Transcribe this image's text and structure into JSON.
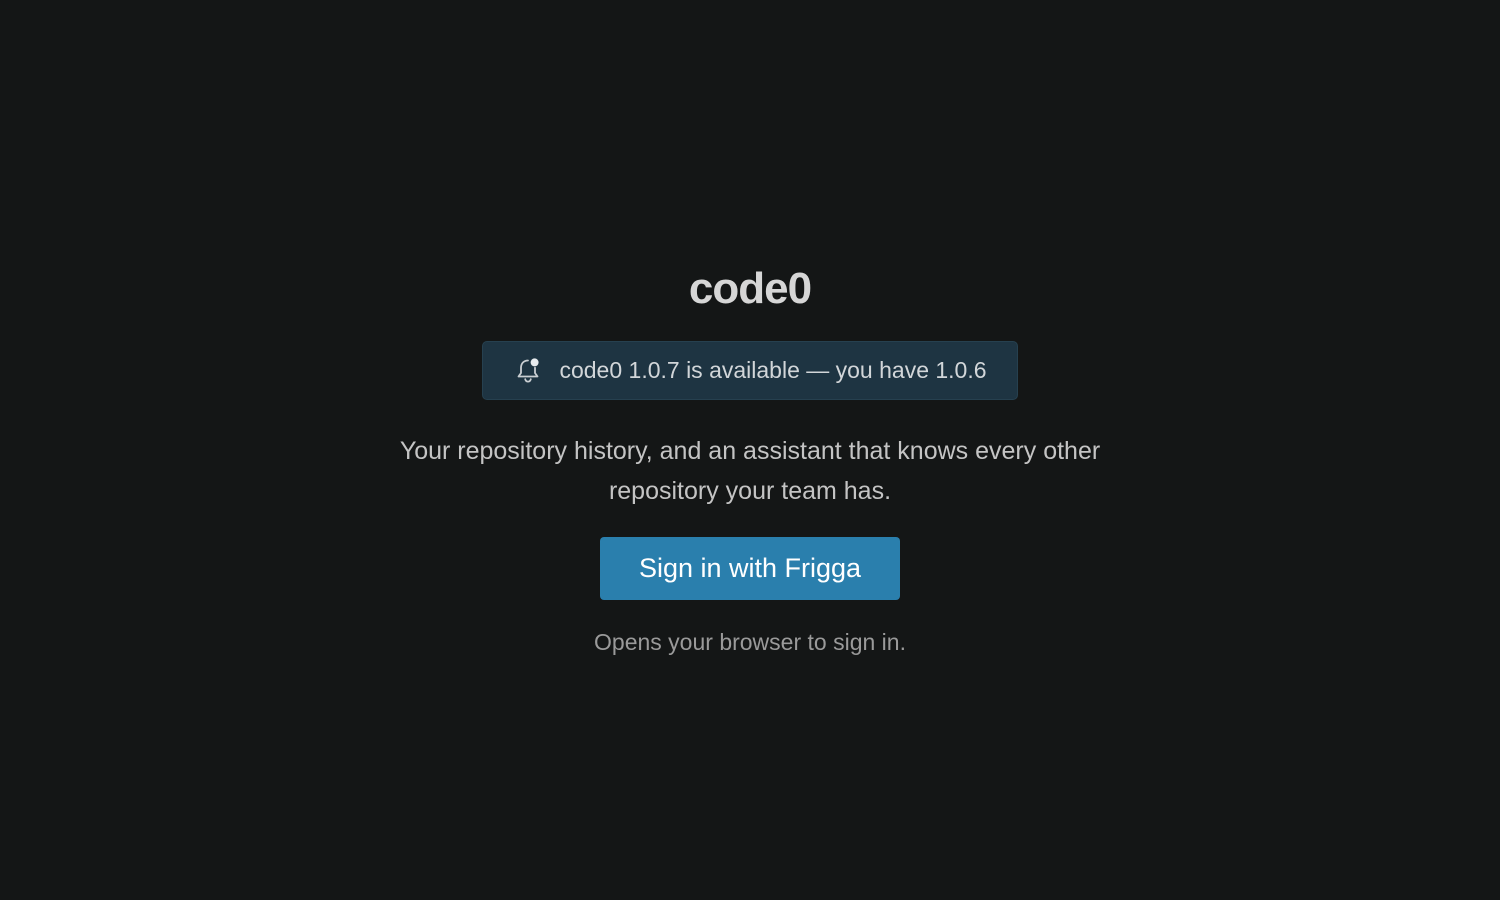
{
  "app": {
    "title": "code0"
  },
  "update_banner": {
    "icon": "bell-notification-icon",
    "text": "code0 1.0.7 is available — you have 1.0.6"
  },
  "tagline": "Your repository history, and an assistant that knows every other repository your team has.",
  "signin": {
    "button_label": "Sign in with Frigga",
    "note": "Opens your browser to sign in."
  },
  "colors": {
    "background": "#141616",
    "banner_background": "#1e3442",
    "button_background": "#2a7fad"
  }
}
